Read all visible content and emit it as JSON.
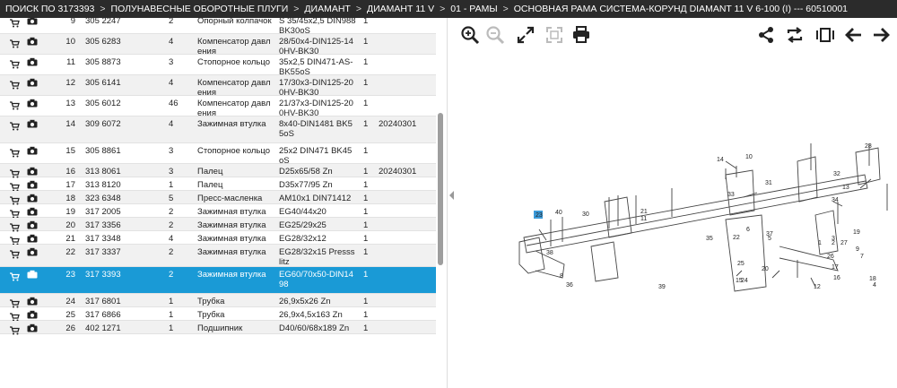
{
  "breadcrumb": [
    "ПОИСК ПО 3173393",
    "ПОЛУНАВЕСНЫЕ ОБОРОТНЫЕ ПЛУГИ",
    "ДИАМАНТ",
    "ДИАМАНТ 11 V",
    "01 - РАМЫ",
    "ОСНОВНАЯ РАМА СИСТЕМА-КОРУНД DIAMANT 11 V 6-100 (I) --- 60510001"
  ],
  "breadcrumb_sep": ">",
  "rows": [
    {
      "pos": "9",
      "art": "305 2247",
      "qty": "2",
      "name": "Опорный колпачок",
      "spec": "S 35/45x2,5 DIN988 BK30oS",
      "one": "1",
      "date": ""
    },
    {
      "pos": "10",
      "art": "305 6283",
      "qty": "4",
      "name": "Компенсатор давления",
      "spec": "28/50x4-DIN125-140HV-BK30",
      "one": "1",
      "date": ""
    },
    {
      "pos": "11",
      "art": "305 8873",
      "qty": "3",
      "name": "Стопорное кольцо",
      "spec": "35x2,5 DIN471-AS-BK55oS",
      "one": "1",
      "date": ""
    },
    {
      "pos": "12",
      "art": "305 6141",
      "qty": "4",
      "name": "Компенсатор давления",
      "spec": "17/30x3-DIN125-200HV-BK30",
      "one": "1",
      "date": ""
    },
    {
      "pos": "13",
      "art": "305 6012",
      "qty": "46",
      "name": "Компенсатор давления",
      "spec": "21/37x3-DIN125-200HV-BK30",
      "one": "1",
      "date": ""
    },
    {
      "pos": "14",
      "art": "309 6072",
      "qty": "4",
      "name": "Зажимная втулка",
      "spec": "8x40-DIN1481 BK55oS",
      "one": "1",
      "date": "20240301"
    },
    {
      "pos": "15",
      "art": "305 8861",
      "qty": "3",
      "name": "Стопорное кольцо",
      "spec": "25x2 DIN471 BK45oS",
      "one": "1",
      "date": ""
    },
    {
      "pos": "16",
      "art": "313 8061",
      "qty": "3",
      "name": "Палец",
      "spec": "D25x65/58 Zn",
      "one": "1",
      "date": "20240301"
    },
    {
      "pos": "17",
      "art": "313 8120",
      "qty": "1",
      "name": "Палец",
      "spec": "D35x77/95 Zn",
      "one": "1",
      "date": ""
    },
    {
      "pos": "18",
      "art": "323 6348",
      "qty": "5",
      "name": "Пресс-масленка",
      "spec": "AM10x1 DIN71412",
      "one": "1",
      "date": ""
    },
    {
      "pos": "19",
      "art": "317 2005",
      "qty": "2",
      "name": "Зажимная втулка",
      "spec": "EG40/44x20",
      "one": "1",
      "date": ""
    },
    {
      "pos": "20",
      "art": "317 3356",
      "qty": "2",
      "name": "Зажимная втулка",
      "spec": "EG25/29x25",
      "one": "1",
      "date": ""
    },
    {
      "pos": "21",
      "art": "317 3348",
      "qty": "4",
      "name": "Зажимная втулка",
      "spec": "EG28/32x12",
      "one": "1",
      "date": ""
    },
    {
      "pos": "22",
      "art": "317 3337",
      "qty": "2",
      "name": "Зажимная втулка",
      "spec": "EG28/32x15 Pressslitz",
      "one": "1",
      "date": ""
    },
    {
      "pos": "23",
      "art": "317 3393",
      "qty": "2",
      "name": "Зажимная втулка",
      "spec": "EG60/70x50-DIN1498",
      "one": "1",
      "date": ""
    },
    {
      "pos": "24",
      "art": "317 6801",
      "qty": "1",
      "name": "Трубка",
      "spec": "26,9x5x26 Zn",
      "one": "1",
      "date": ""
    },
    {
      "pos": "25",
      "art": "317 6866",
      "qty": "1",
      "name": "Трубка",
      "spec": "26,9x4,5x163 Zn",
      "one": "1",
      "date": ""
    },
    {
      "pos": "26",
      "art": "402 1271",
      "qty": "1",
      "name": "Подшипник",
      "spec": "D40/60/68x189 Zn",
      "one": "1",
      "date": ""
    }
  ],
  "selected_pos": "23",
  "toolbar_icons": [
    "zoom-in-icon",
    "zoom-out-icon",
    "expand-icon",
    "fit-icon",
    "print-icon",
    "share-icon",
    "swap-icon",
    "slide-icon",
    "arrow-left-icon",
    "arrow-right-icon"
  ],
  "diagram_labels": [
    "28",
    "14",
    "10",
    "32",
    "31",
    "30",
    "13",
    "40",
    "11",
    "21",
    "34",
    "33",
    "35",
    "22",
    "38",
    "6",
    "5",
    "23",
    "1",
    "2",
    "3",
    "19",
    "26",
    "9",
    "27",
    "37",
    "39",
    "20",
    "25",
    "24",
    "15",
    "7",
    "8",
    "36",
    "12",
    "4",
    "16",
    "17",
    "18"
  ],
  "highlight_label": "23",
  "colors": {
    "topbar": "#2b2b2b",
    "selected": "#1a9ad6",
    "alt_row": "#f1f1f1",
    "highlight": "#3b9ad9"
  }
}
